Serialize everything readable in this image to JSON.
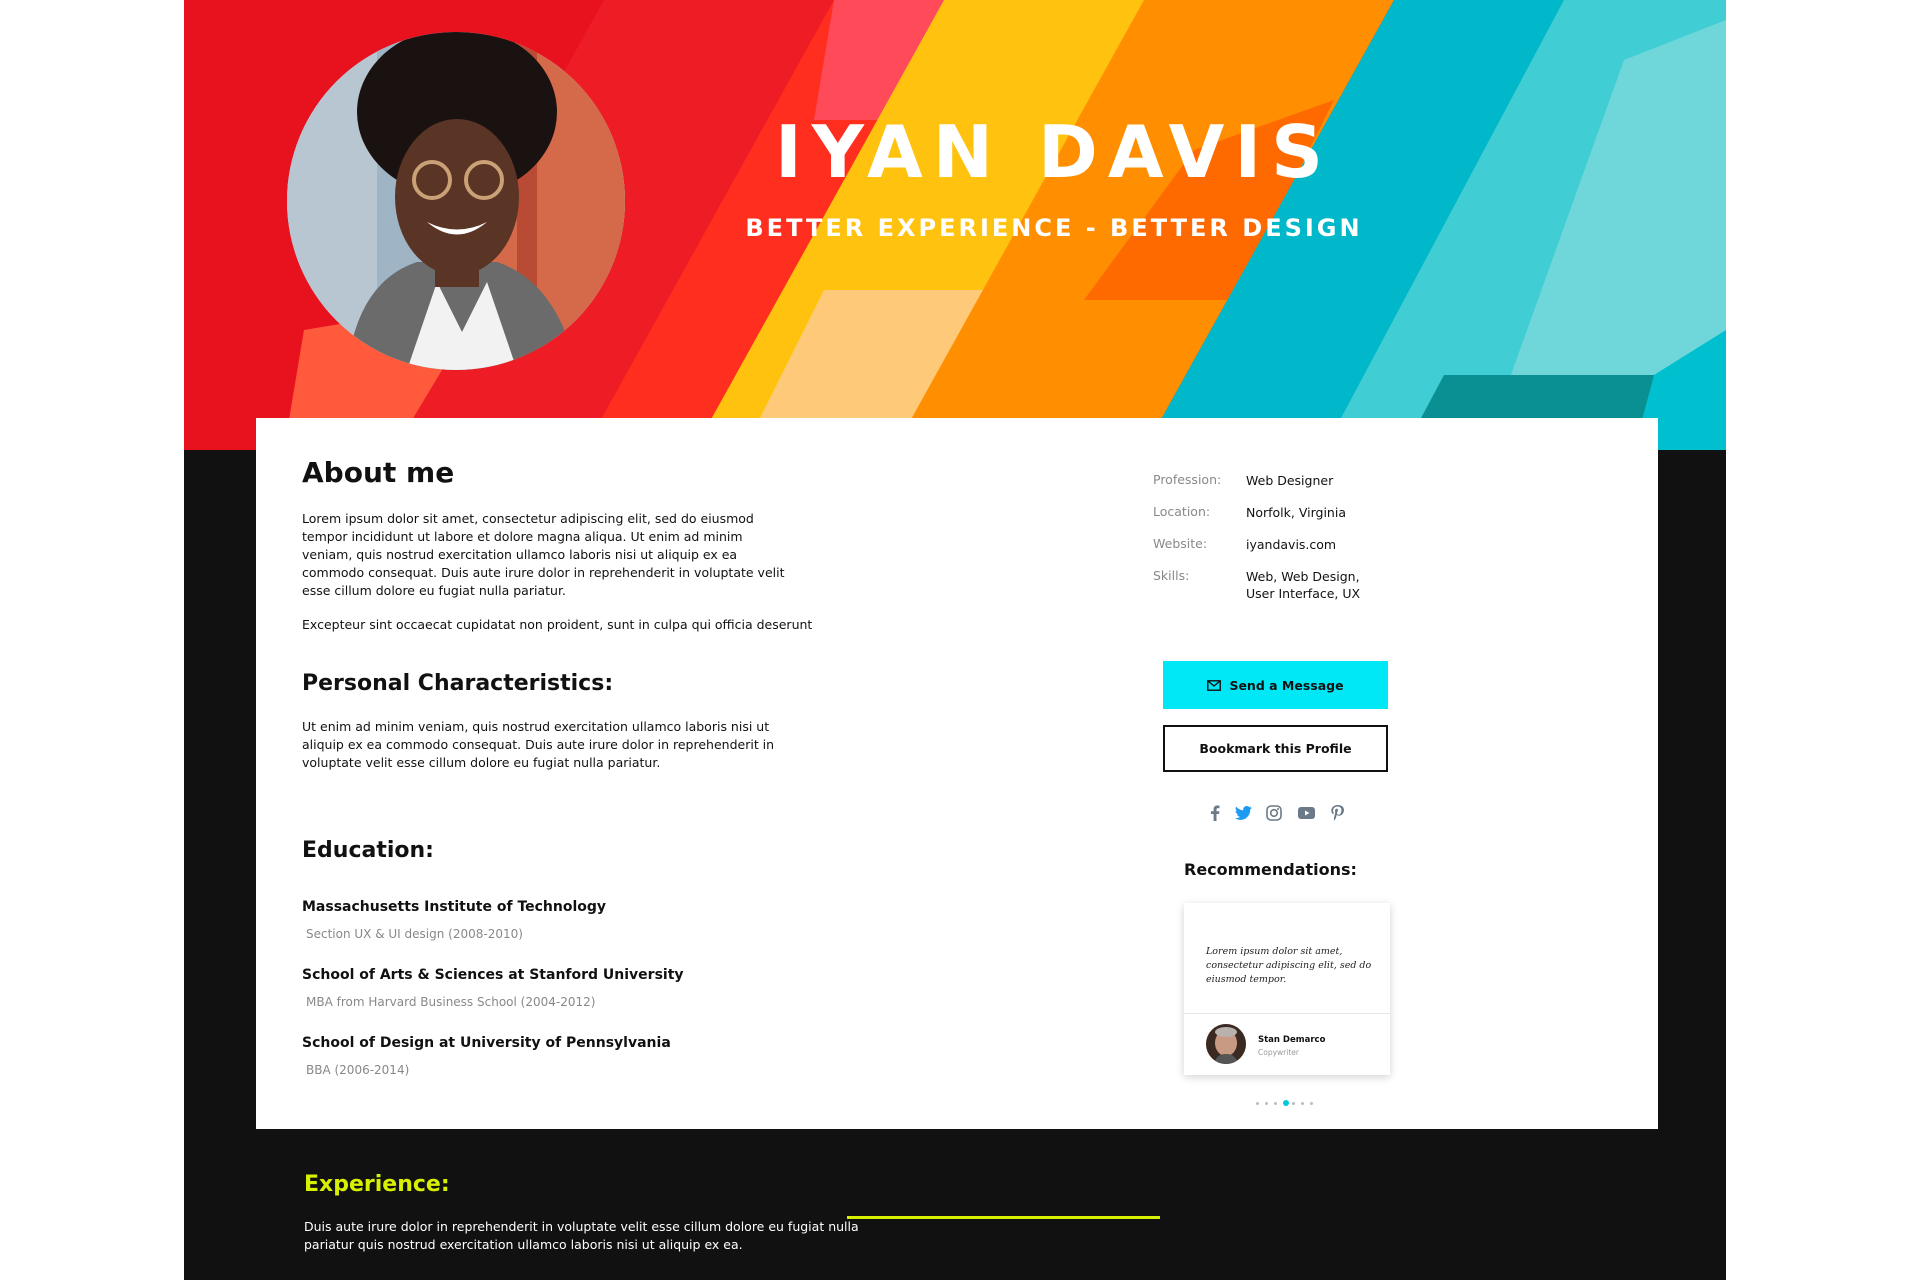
{
  "hero": {
    "name": "IYAN DAVIS",
    "tagline": "BETTER EXPERIENCE - BETTER DESIGN"
  },
  "about": {
    "title": "About me",
    "para1": "Lorem ipsum dolor sit amet, consectetur adipiscing elit, sed do eiusmod tempor incididunt ut labore et dolore magna aliqua. Ut enim ad minim veniam, quis nostrud exercitation ullamco laboris nisi ut aliquip ex ea commodo consequat. Duis aute irure dolor in reprehenderit in voluptate velit esse cillum dolore eu fugiat nulla pariatur.",
    "para2": "Excepteur sint occaecat cupidatat non proident, sunt in culpa qui officia deserunt"
  },
  "characteristics": {
    "title": "Personal Characteristics:",
    "text": "Ut enim ad minim veniam, quis nostrud exercitation ullamco laboris nisi ut aliquip ex ea commodo consequat. Duis aute irure dolor in reprehenderit in voluptate velit esse cillum dolore eu fugiat nulla pariatur."
  },
  "education": {
    "title": "Education:",
    "items": [
      {
        "name": "Massachusetts Institute of Technology",
        "detail": "Section UX & UI design (2008-2010)"
      },
      {
        "name": "School of Arts & Sciences at Stanford University",
        "detail": "MBA from Harvard Business School (2004-2012)"
      },
      {
        "name": "School of Design at University of Pennsylvania",
        "detail": "BBA (2006-2014)"
      }
    ]
  },
  "info": {
    "profession_label": "Profession:",
    "profession_value": "Web Designer",
    "location_label": "Location:",
    "location_value": "Norfolk, Virginia",
    "website_label": "Website:",
    "website_value": "iyandavis.com",
    "skills_label": "Skills:",
    "skills_line1": "Web, Web Design,",
    "skills_line2": "User Interface, UX"
  },
  "actions": {
    "message_label": "Send a Message",
    "bookmark_label": "Bookmark this Profile"
  },
  "socials": [
    "facebook-icon",
    "twitter-icon",
    "instagram-icon",
    "youtube-icon",
    "pinterest-icon"
  ],
  "recommendations": {
    "title": "Recommendations:",
    "quote_line1": "Lorem ipsum dolor sit amet,",
    "quote_line2": "consectetur adipiscing elit, sed do",
    "quote_line3": "eiusmod tempor.",
    "author_name": "Stan Demarco",
    "author_role": "Copywriter",
    "page_count": 7,
    "active_page": 4
  },
  "experience": {
    "title": "Experience:",
    "text": "Duis aute irure dolor in reprehenderit in voluptate velit esse cillum dolore eu fugiat nulla pariatur quis nostrud exercitation ullamco laboris nisi ut aliquip ex ea."
  },
  "colors": {
    "accent_cyan": "#00e7f6",
    "experience_accent": "#d7f000",
    "dark_bg": "#111111"
  }
}
